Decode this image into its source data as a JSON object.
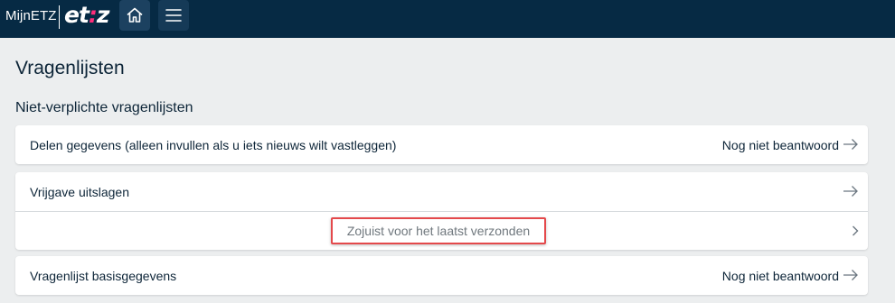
{
  "header": {
    "brand_text": "MijnETZ",
    "logo_text_start": "et",
    "logo_accent": ":",
    "logo_text_end": "z",
    "accent_color": "#ff2d7a",
    "background_color": "#062a44",
    "home_icon": "home-icon",
    "menu_icon": "hamburger-menu-icon"
  },
  "page": {
    "title": "Vragenlijsten",
    "section_title": "Niet-verplichte vragenlijsten"
  },
  "questionnaires": [
    {
      "label": "Delen gegevens (alleen invullen als u iets nieuws wilt vastleggen)",
      "status": "Nog niet beantwoord"
    },
    {
      "label": "Vrijgave uitslagen",
      "status": "",
      "sub_item": "Zojuist voor het laatst verzonden"
    },
    {
      "label": "Vragenlijst basisgegevens",
      "status": "Nog niet beantwoord"
    }
  ]
}
